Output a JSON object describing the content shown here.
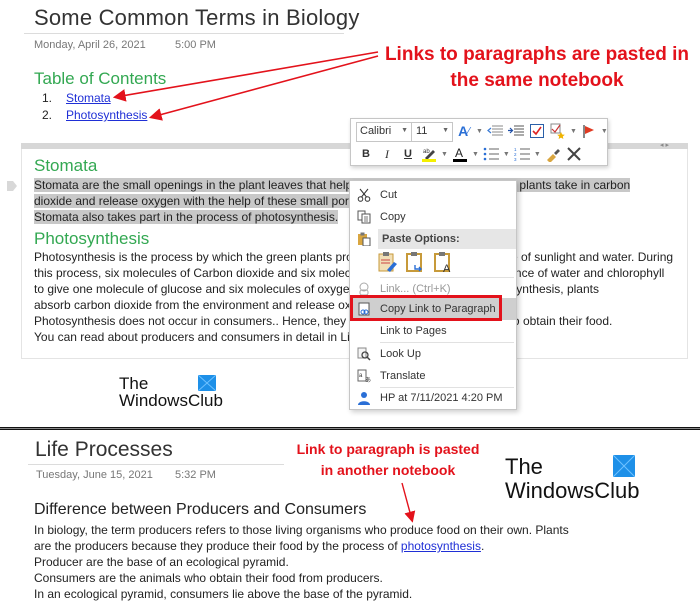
{
  "top_page": {
    "title": "Some Common Terms in Biology",
    "date": "Monday, April 26, 2021",
    "time": "5:00 PM",
    "toc_heading": "Table of Contents",
    "toc": [
      {
        "num": "1.",
        "label": "Stomata"
      },
      {
        "num": "2.",
        "label": "Photosynthesis"
      }
    ],
    "sections": {
      "stomata": {
        "heading": "Stomata",
        "lines": [
          "Stomata are the small openings in the plant leaves that help in the exchange of gases. The plants take in carbon",
          "dioxide and release oxygen with the help of these small pores.",
          "Stomata also takes part in the process of photosynthesis."
        ]
      },
      "photosynthesis": {
        "heading": "Photosynthesis",
        "lines": [
          "Photosynthesis is the process by which the green plants produce their food in the presence of sunlight and water. During",
          "this process, six molecules of Carbon dioxide and six molecules of water react in the presence of water and chlorophyll",
          "to give one molecule of glucose and six molecules of oxygen. During the process of photosynthesis, plants",
          "absorb carbon dioxide from the environment and release oxygen.",
          "Photosynthesis does not occur in consumers.. Hence, they depend on plants (producers) to obtain their food.",
          "You can read about producers and consumers in detail in Life Processes."
        ]
      }
    }
  },
  "annotations": {
    "top": "Links to paragraphs are pasted in the same notebook",
    "bottom": "Link to paragraph is pasted in another notebook"
  },
  "mini_toolbar": {
    "font": "Calibri",
    "size": "11",
    "buttons_row1": [
      "styles",
      "decrease-indent",
      "increase-indent",
      "to-do-tag",
      "find-tags",
      "flag"
    ],
    "buttons_row2": [
      "bold",
      "italic",
      "underline",
      "highlight",
      "font-color",
      "bullets",
      "numbering",
      "format-painter",
      "clear-formatting"
    ],
    "labels": {
      "bold": "B",
      "italic": "I",
      "underline": "U"
    },
    "highlight_color": "#f4f000",
    "font_color": "#000000"
  },
  "context_menu": {
    "items": [
      {
        "label": "Cut",
        "icon": "scissors-icon",
        "enabled": true
      },
      {
        "label": "Copy",
        "icon": "copy-icon",
        "enabled": true
      },
      {
        "label": "Paste Options:",
        "icon": "paste-icon",
        "header": true
      },
      {
        "label": "Link... (Ctrl+K)",
        "icon": "link-icon",
        "enabled": false
      },
      {
        "label": "Copy Link to Paragraph",
        "icon": "copy-link-icon",
        "enabled": true,
        "highlighted": true
      },
      {
        "label": "Link to Pages",
        "icon": "",
        "enabled": true
      },
      {
        "label": "Look Up",
        "icon": "look-up-icon",
        "enabled": true
      },
      {
        "label": "Translate",
        "icon": "translate-icon",
        "enabled": true
      },
      {
        "label": "HP at 7/11/2021 4:20 PM",
        "icon": "author-icon",
        "enabled": true
      }
    ],
    "paste_options": [
      "keep-source-formatting",
      "merge-formatting",
      "keep-text-only"
    ]
  },
  "logo": {
    "line1": "The",
    "line2": "WindowsClub",
    "flag_color": "#1e90e8"
  },
  "bottom_page": {
    "title": "Life Processes",
    "date": "Tuesday, June 15, 2021",
    "time": "5:32 PM",
    "heading": "Difference between Producers and Consumers",
    "line1": "In biology, the term producers refers to those living organisms who produce food on their own. Plants",
    "line2_before": "are the producers because they produce their food by the process of ",
    "line2_link": "photosynthesis",
    "line2_after": ".",
    "line3": "Producer are the base of an ecological pyramid.",
    "line4": "Consumers are the animals who obtain their food from producers.",
    "line5": "In an ecological pyramid, consumers lie above the base of the pyramid."
  },
  "colors": {
    "heading_green": "#33a852",
    "link_blue": "#1f2fd6",
    "annotation_red": "#e3121b",
    "selection_gray": "#c8c8c8"
  }
}
